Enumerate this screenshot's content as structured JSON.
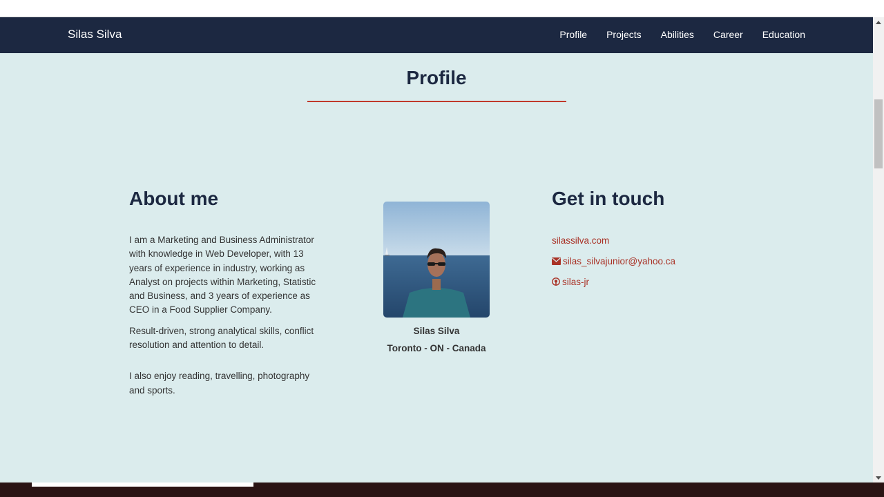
{
  "nav": {
    "brand": "Silas Silva",
    "links": [
      "Profile",
      "Projects",
      "Abilities",
      "Career",
      "Education"
    ]
  },
  "profile": {
    "title": "Profile",
    "about": {
      "heading": "About me",
      "paragraphs": [
        "I am a Marketing and Business Administrator with knowledge in Web Developer, with 13 years of experience in industry, working as Analyst on projects within Marketing, Statistic and Business, and 3 years of experience as CEO in a Food Supplier Company.",
        "Result-driven, strong analytical skills, conflict resolution and attention to detail.",
        "I also enjoy reading, travelling, photography and sports."
      ]
    },
    "person": {
      "name": "Silas Silva",
      "location": "Toronto - ON - Canada"
    },
    "contact": {
      "heading": "Get in touch",
      "website": "silassilva.com",
      "email": "silas_silvajunior@yahoo.ca",
      "github": "silas-jr"
    }
  },
  "icons": {
    "email": "envelope-icon",
    "github": "github-icon"
  },
  "colors": {
    "navbar": "#1c2841",
    "background": "#dbeced",
    "accent": "#c0392b",
    "link": "#a93226"
  }
}
